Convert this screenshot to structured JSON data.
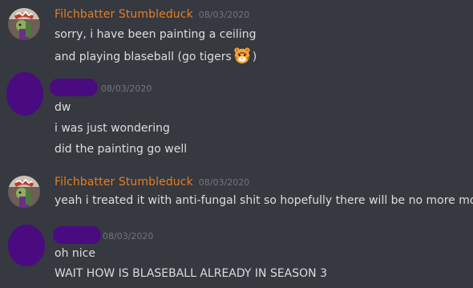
{
  "messages": [
    {
      "author": "Filchbatter Stumbleduck",
      "timestamp": "08/03/2020",
      "lines": [
        "sorry, i have been painting a ceiling",
        "and playing blaseball (go tigers",
        ")"
      ],
      "emoji": "tiger-face-emoji"
    },
    {
      "author": "",
      "timestamp": "08/03/2020",
      "lines": [
        "dw",
        "i was just wondering",
        "did the painting go well"
      ]
    },
    {
      "author": "Filchbatter Stumbleduck",
      "timestamp": "08/03/2020",
      "lines": [
        "yeah i treated it with anti-fungal shit so hopefully there will be no more mould"
      ]
    },
    {
      "author": "",
      "timestamp": "08/03/2020",
      "lines": [
        "oh nice",
        "WAIT HOW IS BLASEBALL ALREADY IN SEASON 3"
      ]
    }
  ],
  "colors": {
    "background": "#36393f",
    "username": "#e67e22",
    "text": "#dcddde",
    "timestamp": "#72767d",
    "redaction": "#4a0a80"
  }
}
